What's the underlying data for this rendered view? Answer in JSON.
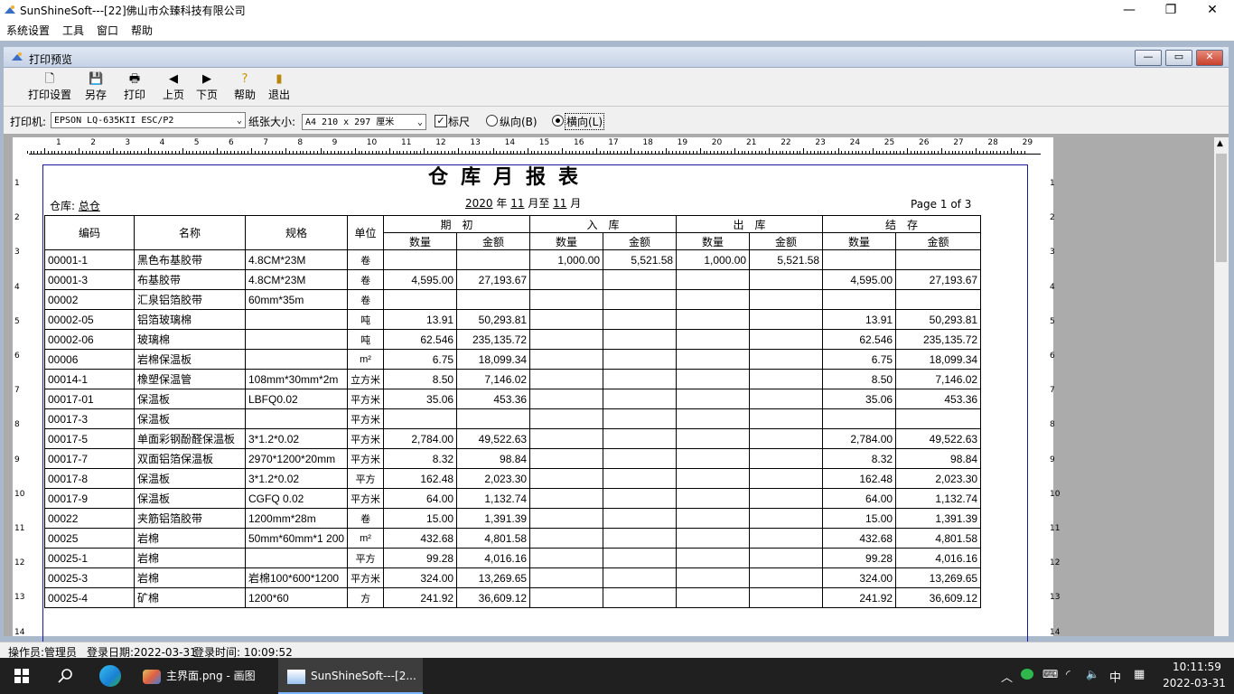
{
  "window": {
    "title": "SunShineSoft---[22]佛山市众臻科技有限公司",
    "minimize": "—",
    "maximize": "❐",
    "close": "✕"
  },
  "menubar": [
    "系统设置",
    "工具",
    "窗口",
    "帮助"
  ],
  "child_window": {
    "title": "打印预览",
    "min": "—",
    "max": "▭",
    "close": "✕"
  },
  "toolbar": {
    "print_setup": "打印设置",
    "save_as": "另存",
    "print": "打印",
    "prev_page": "上页",
    "next_page": "下页",
    "help": "帮助",
    "exit": "退出"
  },
  "options": {
    "printer_label": "打印机:",
    "printer_value": "EPSON LQ-635KII ESC/P2",
    "paper_label": "纸张大小:",
    "paper_value": "A4 210 x 297 厘米",
    "ruler_label": "标尺",
    "ruler_checked": true,
    "portrait_label": "纵向(B)",
    "landscape_label": "横向(L)",
    "orientation": "landscape"
  },
  "ruler": {
    "h_numbers": [
      "1",
      "2",
      "3",
      "4",
      "5",
      "6",
      "7",
      "8",
      "9",
      "10",
      "11",
      "12",
      "13",
      "14",
      "15",
      "16",
      "17",
      "18",
      "19",
      "20",
      "21",
      "22",
      "23",
      "24",
      "25",
      "26",
      "27",
      "28",
      "29"
    ],
    "v_numbers": [
      "1",
      "2",
      "3",
      "4",
      "5",
      "6",
      "7",
      "8",
      "9",
      "10",
      "11",
      "12",
      "13",
      "14"
    ]
  },
  "report": {
    "title": "仓库月报表",
    "warehouse_label": "仓库:",
    "warehouse": "总仓",
    "year": "2020",
    "year_unit": "年",
    "month_from": "11",
    "month_to_label": "月至",
    "month_to": "11",
    "month_unit": "月",
    "page_info": "Page 1 of 3",
    "headers": {
      "code": "编码",
      "name": "名称",
      "spec": "规格",
      "unit": "单位",
      "opening": "期　初",
      "inbound": "入　库",
      "outbound": "出　库",
      "closing": "结　存",
      "qty": "数量",
      "amount": "金额"
    },
    "rows": [
      [
        "00001-1",
        "黑色布基胶带",
        "4.8CM*23M",
        "卷",
        "",
        "",
        "1,000.00",
        "5,521.58",
        "1,000.00",
        "5,521.58",
        "",
        ""
      ],
      [
        "00001-3",
        "布基胶带",
        "4.8CM*23M",
        "卷",
        "4,595.00",
        "27,193.67",
        "",
        "",
        "",
        "",
        "4,595.00",
        "27,193.67"
      ],
      [
        "00002",
        "汇泉铝箔胶带",
        "60mm*35m",
        "卷",
        "",
        "",
        "",
        "",
        "",
        "",
        "",
        ""
      ],
      [
        "00002-05",
        "铝箔玻璃棉",
        "",
        "吨",
        "13.91",
        "50,293.81",
        "",
        "",
        "",
        "",
        "13.91",
        "50,293.81"
      ],
      [
        "00002-06",
        "玻璃棉",
        "",
        "吨",
        "62.546",
        "235,135.72",
        "",
        "",
        "",
        "",
        "62.546",
        "235,135.72"
      ],
      [
        "00006",
        "岩棉保温板",
        "",
        "m²",
        "6.75",
        "18,099.34",
        "",
        "",
        "",
        "",
        "6.75",
        "18,099.34"
      ],
      [
        "00014-1",
        "橡塑保温管",
        "108mm*30mm*2m",
        "立方米",
        "8.50",
        "7,146.02",
        "",
        "",
        "",
        "",
        "8.50",
        "7,146.02"
      ],
      [
        "00017-01",
        "保温板",
        "LBFQ0.02",
        "平方米",
        "35.06",
        "453.36",
        "",
        "",
        "",
        "",
        "35.06",
        "453.36"
      ],
      [
        "00017-3",
        "保温板",
        "",
        "平方米",
        "",
        "",
        "",
        "",
        "",
        "",
        "",
        ""
      ],
      [
        "00017-5",
        "单面彩钢酚醛保温板",
        "3*1.2*0.02",
        "平方米",
        "2,784.00",
        "49,522.63",
        "",
        "",
        "",
        "",
        "2,784.00",
        "49,522.63"
      ],
      [
        "00017-7",
        "双面铝箔保温板",
        "2970*1200*20mm",
        "平方米",
        "8.32",
        "98.84",
        "",
        "",
        "",
        "",
        "8.32",
        "98.84"
      ],
      [
        "00017-8",
        "保温板",
        "3*1.2*0.02",
        "平方",
        "162.48",
        "2,023.30",
        "",
        "",
        "",
        "",
        "162.48",
        "2,023.30"
      ],
      [
        "00017-9",
        "保温板",
        "CGFQ 0.02",
        "平方米",
        "64.00",
        "1,132.74",
        "",
        "",
        "",
        "",
        "64.00",
        "1,132.74"
      ],
      [
        "00022",
        "夹筋铝箔胶带",
        "1200mm*28m",
        "卷",
        "15.00",
        "1,391.39",
        "",
        "",
        "",
        "",
        "15.00",
        "1,391.39"
      ],
      [
        "00025",
        "岩棉",
        "50mm*60mm*1 200",
        "m²",
        "432.68",
        "4,801.58",
        "",
        "",
        "",
        "",
        "432.68",
        "4,801.58"
      ],
      [
        "00025-1",
        "岩棉",
        "",
        "平方",
        "99.28",
        "4,016.16",
        "",
        "",
        "",
        "",
        "99.28",
        "4,016.16"
      ],
      [
        "00025-3",
        "岩棉",
        "岩棉100*600*1200",
        "平方米",
        "324.00",
        "13,269.65",
        "",
        "",
        "",
        "",
        "324.00",
        "13,269.65"
      ],
      [
        "00025-4",
        "矿棉",
        "1200*60",
        "方",
        "241.92",
        "36,609.12",
        "",
        "",
        "",
        "",
        "241.92",
        "36,609.12"
      ]
    ]
  },
  "statusbar": {
    "operator": "操作员:管理员",
    "login_date": "登录日期:2022-03-31",
    "login_time": "登录时间: 10:09:52"
  },
  "taskbar": {
    "task1": "主界面.png - 画图",
    "task2": "SunShineSoft---[2...",
    "ime": "中",
    "time": "10:11:59",
    "date": "2022-03-31"
  },
  "colors": {
    "page_border": "#1a1aa0",
    "preview_bg": "#ababab",
    "taskbar": "#202020",
    "close_red": "#d9534f"
  }
}
